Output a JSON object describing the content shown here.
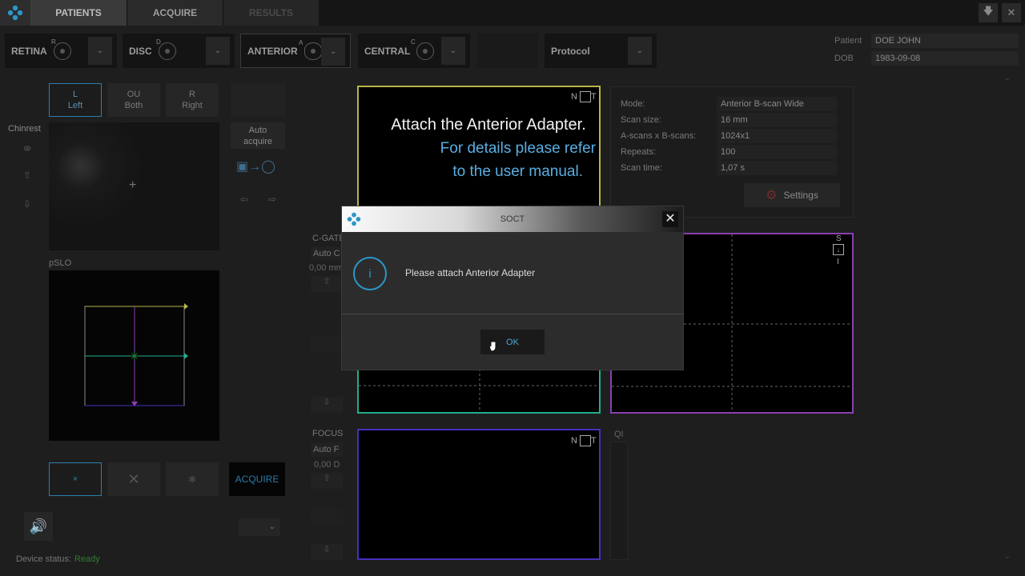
{
  "topbar": {
    "tabs": [
      "PATIENTS",
      "ACQUIRE",
      "RESULTS"
    ]
  },
  "scan_types": [
    {
      "label": "RETINA",
      "badge": "R"
    },
    {
      "label": "DISC",
      "badge": "D"
    },
    {
      "label": "ANTERIOR",
      "badge": "A"
    },
    {
      "label": "CENTRAL",
      "badge": "C"
    }
  ],
  "protocol_label": "Protocol",
  "patient": {
    "patient_label": "Patient",
    "patient_value": "DOE JOHN",
    "dob_label": "DOB",
    "dob_value": "1983-09-08"
  },
  "eye_select": [
    {
      "top": "L",
      "bottom": "Left"
    },
    {
      "top": "OU",
      "bottom": "Both"
    },
    {
      "top": "R",
      "bottom": "Right"
    }
  ],
  "chinrest_label": "Chinrest",
  "auto_acquire": [
    "Auto",
    "acquire"
  ],
  "pslo_label": "pSLO",
  "cgate": {
    "label": "C-GATE",
    "auto": "Auto C",
    "value": "0,00 mm"
  },
  "focus": {
    "label": "FOCUS",
    "auto": "Auto F",
    "value": "0,00 D"
  },
  "qi_label": "QI",
  "acquire_label": "ACQUIRE",
  "device_status": {
    "label": "Device status:",
    "value": "Ready"
  },
  "overlay": {
    "line1": "Attach the Anterior Adapter.",
    "line2": "For details please refer",
    "line3": "to the user manual."
  },
  "scan_info": {
    "rows": [
      {
        "label": "Mode:",
        "value": "Anterior B-scan Wide"
      },
      {
        "label": "Scan size:",
        "value": "16 mm"
      },
      {
        "label": "A-scans x B-scans:",
        "value": "1024x1"
      },
      {
        "label": "Repeats:",
        "value": "100"
      },
      {
        "label": "Scan time:",
        "value": "1,07 s"
      }
    ],
    "settings_label": "Settings"
  },
  "frame_labels": {
    "nt": "N",
    "tt": "T",
    "s": "S",
    "i": "I"
  },
  "dialog": {
    "title": "SOCT",
    "message": "Please attach Anterior Adapter",
    "ok_label": "OK",
    "info_glyph": "i"
  },
  "colors": {
    "accent": "#2b96c8",
    "yellow_frame": "#b7b54a",
    "teal_frame": "#1fae8e",
    "purple_frame": "#8a3fb3",
    "blue_frame": "#4a2fbf",
    "ready": "#2f7d2f"
  }
}
